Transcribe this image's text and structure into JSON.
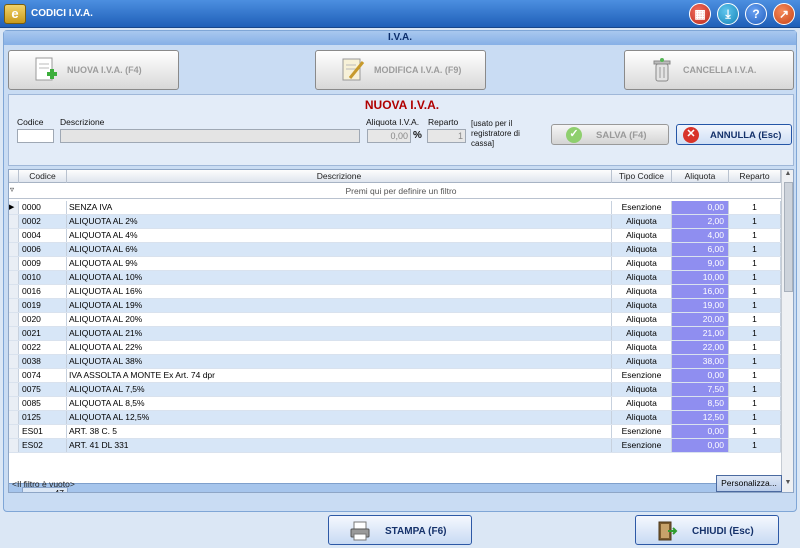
{
  "window": {
    "title": "CODICI I.V.A."
  },
  "titlebar_buttons": [
    {
      "icon": "calculator-icon"
    },
    {
      "icon": "download-icon"
    },
    {
      "icon": "help-icon",
      "glyph": "?"
    },
    {
      "icon": "exit-icon"
    }
  ],
  "header": {
    "title": "I.V.A."
  },
  "toolbar": {
    "nuova": "NUOVA I.V.A. (F4)",
    "modifica": "MODIFICA I.V.A. (F9)",
    "cancella": "CANCELLA I.V.A."
  },
  "form": {
    "title": "NUOVA I.V.A.",
    "codice_label": "Codice",
    "codice_value": "",
    "descrizione_label": "Descrizione",
    "descrizione_value": "",
    "aliquota_label": "Aliquota I.V.A.",
    "aliquota_value": "0,00",
    "percent_symbol": "%",
    "reparto_label": "Reparto",
    "reparto_value": "1",
    "reparto_note": "[usato per il registratore di cassa]",
    "salva": "SALVA (F4)",
    "annulla": "ANNULLA  (Esc)"
  },
  "grid": {
    "columns": [
      "Codice",
      "Descrizione",
      "Tipo Codice",
      "Aliquota",
      "Reparto"
    ],
    "filter_placeholder": "Premi qui per definire un filtro",
    "rows": [
      {
        "codice": "0000",
        "descrizione": "SENZA IVA",
        "tipo": "Esenzione",
        "aliquota": "0,00",
        "reparto": "1"
      },
      {
        "codice": "0002",
        "descrizione": "ALIQUOTA AL 2%",
        "tipo": "Aliquota",
        "aliquota": "2,00",
        "reparto": "1"
      },
      {
        "codice": "0004",
        "descrizione": "ALIQUOTA AL 4%",
        "tipo": "Aliquota",
        "aliquota": "4,00",
        "reparto": "1"
      },
      {
        "codice": "0006",
        "descrizione": "ALIQUOTA AL 6%",
        "tipo": "Aliquota",
        "aliquota": "6,00",
        "reparto": "1"
      },
      {
        "codice": "0009",
        "descrizione": "ALIQUOTA AL 9%",
        "tipo": "Aliquota",
        "aliquota": "9,00",
        "reparto": "1"
      },
      {
        "codice": "0010",
        "descrizione": "ALIQUOTA AL 10%",
        "tipo": "Aliquota",
        "aliquota": "10,00",
        "reparto": "1"
      },
      {
        "codice": "0016",
        "descrizione": "ALIQUOTA AL 16%",
        "tipo": "Aliquota",
        "aliquota": "16,00",
        "reparto": "1"
      },
      {
        "codice": "0019",
        "descrizione": "ALIQUOTA AL 19%",
        "tipo": "Aliquota",
        "aliquota": "19,00",
        "reparto": "1"
      },
      {
        "codice": "0020",
        "descrizione": "ALIQUOTA AL 20%",
        "tipo": "Aliquota",
        "aliquota": "20,00",
        "reparto": "1"
      },
      {
        "codice": "0021",
        "descrizione": "ALIQUOTA AL 21%",
        "tipo": "Aliquota",
        "aliquota": "21,00",
        "reparto": "1"
      },
      {
        "codice": "0022",
        "descrizione": "ALIQUOTA AL 22%",
        "tipo": "Aliquota",
        "aliquota": "22,00",
        "reparto": "1"
      },
      {
        "codice": "0038",
        "descrizione": "ALIQUOTA AL 38%",
        "tipo": "Aliquota",
        "aliquota": "38,00",
        "reparto": "1"
      },
      {
        "codice": "0074",
        "descrizione": "IVA ASSOLTA A MONTE Ex Art. 74 dpr",
        "tipo": "Esenzione",
        "aliquota": "0,00",
        "reparto": "1"
      },
      {
        "codice": "0075",
        "descrizione": "ALIQUOTA AL 7,5%",
        "tipo": "Aliquota",
        "aliquota": "7,50",
        "reparto": "1"
      },
      {
        "codice": "0085",
        "descrizione": "ALIQUOTA AL 8,5%",
        "tipo": "Aliquota",
        "aliquota": "8,50",
        "reparto": "1"
      },
      {
        "codice": "0125",
        "descrizione": "ALIQUOTA AL 12,5%",
        "tipo": "Aliquota",
        "aliquota": "12,50",
        "reparto": "1"
      },
      {
        "codice": "ES01",
        "descrizione": "ART. 38  C. 5",
        "tipo": "Esenzione",
        "aliquota": "0,00",
        "reparto": "1"
      },
      {
        "codice": "ES02",
        "descrizione": "ART. 41 DL 331",
        "tipo": "Esenzione",
        "aliquota": "0,00",
        "reparto": "1"
      }
    ],
    "footer_count": "47",
    "filter_status": "<Il filtro è vuoto>",
    "personalizza": "Personalizza..."
  },
  "bottom": {
    "stampa": "STAMPA  (F6)",
    "chiudi": "CHIUDI   (Esc)"
  },
  "colors": {
    "aliquota_cell": "#8f8ef0",
    "form_title": "#b00000",
    "titlebar": "#1f5fb8"
  }
}
